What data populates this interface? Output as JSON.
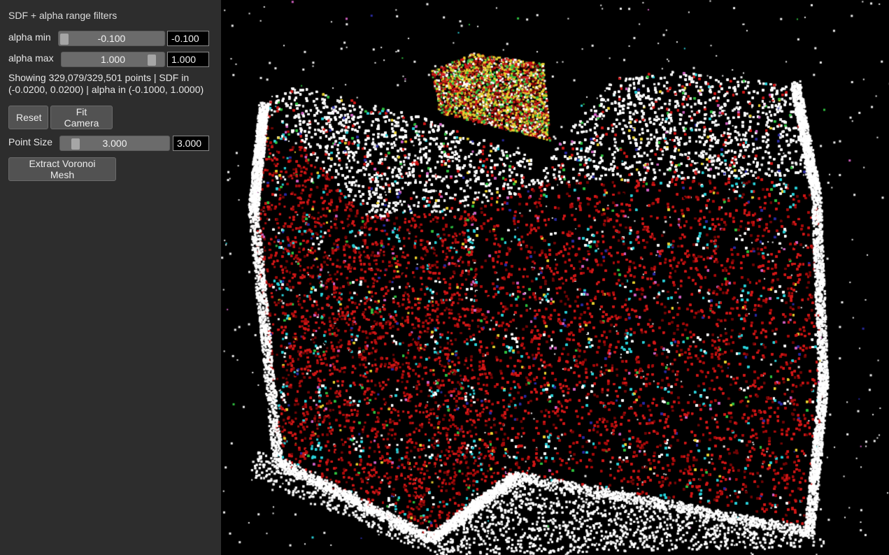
{
  "panel": {
    "title": "SDF + alpha range filters",
    "alpha_min": {
      "label": "alpha min",
      "slider_text": "-0.100",
      "value": "-0.100"
    },
    "alpha_max": {
      "label": "alpha max",
      "slider_text": "1.000",
      "value": "1.000"
    },
    "status": "Showing 329,079/329,501 points | SDF in (-0.0200, 0.0200) | alpha in (-0.1000, 1.0000)",
    "reset_label": "Reset",
    "fit_camera_label": "Fit Camera",
    "point_size": {
      "label": "Point Size",
      "slider_text": "3.000",
      "value": "3.000"
    },
    "extract_label": "Extract Voronoi Mesh"
  },
  "viewport": {
    "background": "#000000",
    "palette": [
      "#ffffff",
      "#e8e8e8",
      "#d01818",
      "#a80c0c",
      "#6e0606",
      "#2bd0d8",
      "#e8d030",
      "#30c040",
      "#2a2aa0",
      "#d060c0"
    ]
  }
}
